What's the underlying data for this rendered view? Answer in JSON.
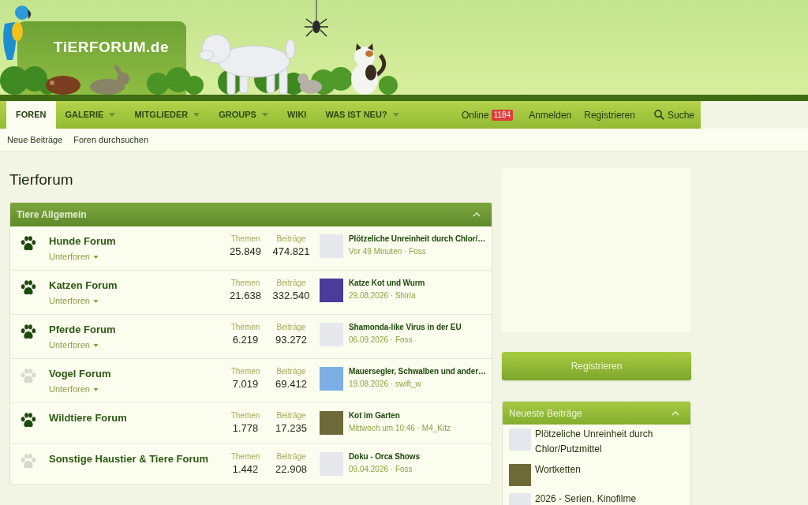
{
  "logo": {
    "text": "TiERFORUM.de"
  },
  "nav": {
    "items": [
      {
        "label": "FOREN",
        "selected": true,
        "dropdown": false
      },
      {
        "label": "GALERIE",
        "selected": false,
        "dropdown": true
      },
      {
        "label": "MITGLIEDER",
        "selected": false,
        "dropdown": true
      },
      {
        "label": "GROUPS",
        "selected": false,
        "dropdown": true
      },
      {
        "label": "WIKI",
        "selected": false,
        "dropdown": false
      },
      {
        "label": "WAS IST NEU?",
        "selected": false,
        "dropdown": true
      }
    ],
    "online": {
      "label": "Online",
      "count": "1184"
    },
    "links": [
      "Anmelden",
      "Registrieren"
    ],
    "search": {
      "label": "Suche"
    }
  },
  "subnav": {
    "links": [
      "Neue Beiträge",
      "Foren durchsuchen"
    ]
  },
  "page_title": "Tierforum",
  "categories": [
    {
      "title": "Tiere Allgemein",
      "expanded": true,
      "forums": [
        {
          "name": "Hunde Forum",
          "unread": true,
          "subforums": "Unterforen",
          "stats": [
            {
              "label": "Themen",
              "value": "25.849"
            },
            {
              "label": "Beiträge",
              "value": "474.821"
            }
          ],
          "last_post": {
            "title": "Plötzeliche Unreinheit durch Chlor/…",
            "meta": "Vor 49 Minuten · Foss",
            "color": "#e6e8ee"
          }
        },
        {
          "name": "Katzen Forum",
          "unread": true,
          "subforums": "Unterforen",
          "stats": [
            {
              "label": "Themen",
              "value": "21.638"
            },
            {
              "label": "Beiträge",
              "value": "332.540"
            }
          ],
          "last_post": {
            "title": "Katze Kot und Wurm",
            "meta": "29.08.2026 · Shiria",
            "color": "#4b3c9c"
          }
        },
        {
          "name": "Pferde Forum",
          "unread": true,
          "subforums": "Unterforen",
          "stats": [
            {
              "label": "Themen",
              "value": "6.219"
            },
            {
              "label": "Beiträge",
              "value": "93.272"
            }
          ],
          "last_post": {
            "title": "Shamonda-like Virus in der EU",
            "meta": "06.09.2026 · Foss",
            "color": "#e6e8ee"
          }
        },
        {
          "name": "Vogel Forum",
          "unread": false,
          "subforums": "Unterforen",
          "stats": [
            {
              "label": "Themen",
              "value": "7.019"
            },
            {
              "label": "Beiträge",
              "value": "69.412"
            }
          ],
          "last_post": {
            "title": "Mauersegler, Schwalben und ander…",
            "meta": "19.08.2026 · swift_w",
            "color": "#7eaee6"
          }
        },
        {
          "name": "Wildtiere Forum",
          "unread": true,
          "stats": [
            {
              "label": "Themen",
              "value": "1.778"
            },
            {
              "label": "Beiträge",
              "value": "17.235"
            }
          ],
          "last_post": {
            "title": "Kot im Garten",
            "meta": "Mittwoch um 10:46 · M4_Kitz",
            "color": "#6e6a38"
          }
        },
        {
          "name": "Sonstige Haustier & Tiere Forum",
          "unread": false,
          "stats": [
            {
              "label": "Themen",
              "value": "1.442"
            },
            {
              "label": "Beiträge",
              "value": "22.908"
            }
          ],
          "last_post": {
            "title": "Doku - Orca Shows",
            "meta": "09.04.2026 · Foss",
            "color": "#e6e8ee"
          }
        }
      ]
    }
  ],
  "sidebar": {
    "register_button": "Registrieren",
    "latest": {
      "title": "Neueste Beiträge",
      "expanded": true,
      "items": [
        {
          "title": "Plötzeliche Unreinheit durch Chlor/Putzmittel",
          "color": "#e6e8ee"
        },
        {
          "title": "Wortketten",
          "color": "#6e6a38"
        },
        {
          "title": "2026 - Serien, Kinofilme",
          "color": "#e6e8ee"
        }
      ]
    }
  }
}
